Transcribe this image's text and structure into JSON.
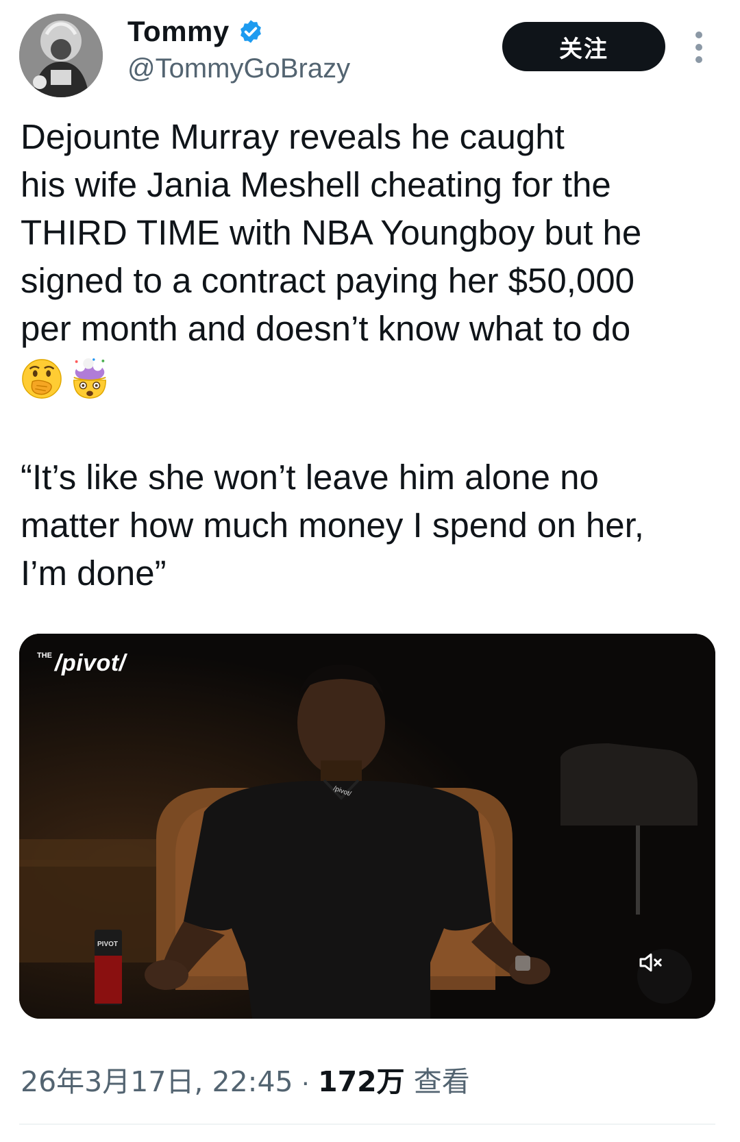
{
  "author": {
    "display_name": "Tommy",
    "handle": "@TommyGoBrazy",
    "verified_icon": "verified-badge-icon",
    "avatar_icon": "avatar-photo"
  },
  "actions": {
    "follow_label": "关注",
    "more_icon": "more-vertical-icon"
  },
  "tweet": {
    "text": "Dejounte Murray reveals he caught\nhis wife Jania Meshell cheating for the\nTHIRD TIME with NBA Youngboy but he\nsigned to a contract paying her $50,000\nper month and doesn’t know what to do",
    "emojis": [
      "face-with-hand-over-mouth-emoji",
      "exploding-head-emoji"
    ],
    "quote": "“It’s like she won’t leave him alone no\nmatter how much money I spend on her,\nI’m done”"
  },
  "video": {
    "watermark_the": "THE",
    "watermark_brand": "/pivot/",
    "mute_icon": "muted-speaker-icon",
    "can_label": "PIVOT",
    "shirt_logo": "/pivot/"
  },
  "meta": {
    "timestamp": "26年3月17日, 22:45",
    "separator": " · ",
    "views": "172万",
    "views_label": " 查看"
  },
  "colors": {
    "text_primary": "#0f1419",
    "text_secondary": "#536471",
    "verified_blue": "#1d9bf0",
    "button_dark": "#0f1419"
  }
}
